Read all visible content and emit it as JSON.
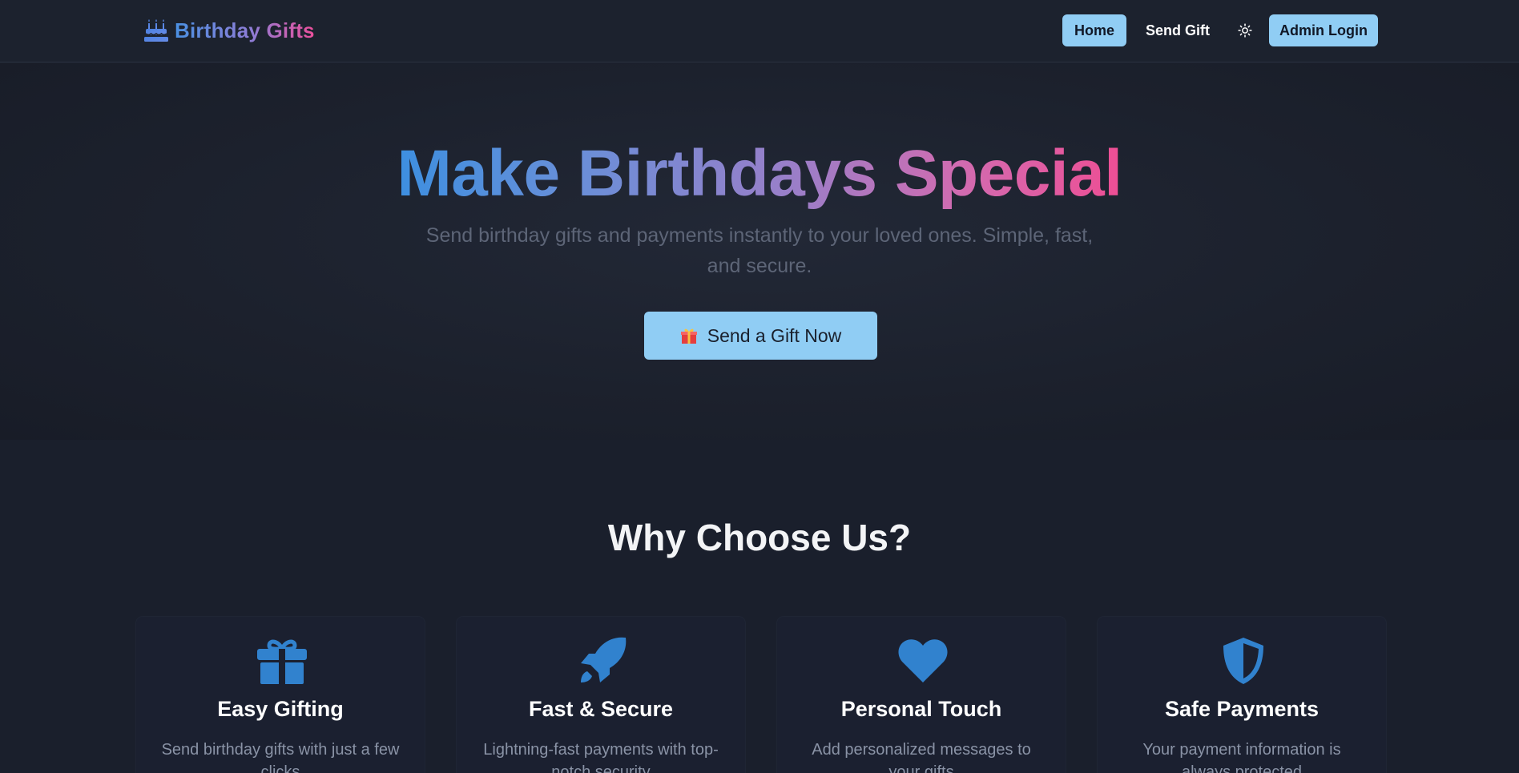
{
  "nav": {
    "brand": "Birthday Gifts",
    "brand_icon": "birthday-cake-icon",
    "home_label": "Home",
    "send_gift_label": "Send Gift",
    "theme_icon": "sun-icon",
    "admin_label": "Admin Login"
  },
  "hero": {
    "title": "Make Birthdays Special",
    "subtitle": "Send birthday gifts and payments instantly to your loved ones. Simple, fast, and secure.",
    "cta_label": "Send a Gift Now",
    "cta_icon": "wrapped-gift-icon"
  },
  "why": {
    "title": "Why Choose Us?",
    "cards": [
      {
        "icon": "gift-icon",
        "title": "Easy Gifting",
        "desc": "Send birthday gifts with just a few clicks"
      },
      {
        "icon": "rocket-icon",
        "title": "Fast & Secure",
        "desc": "Lightning-fast payments with top-notch security"
      },
      {
        "icon": "heart-icon",
        "title": "Personal Touch",
        "desc": "Add personalized messages to your gifts"
      },
      {
        "icon": "shield-icon",
        "title": "Safe Payments",
        "desc": "Your payment information is always protected"
      }
    ]
  },
  "colors": {
    "background": "#1a1f2c",
    "accent": "#90cdf4",
    "icon_blue": "#3182ce",
    "gradient_start": "#3d8fe0",
    "gradient_end": "#ee4e94"
  }
}
